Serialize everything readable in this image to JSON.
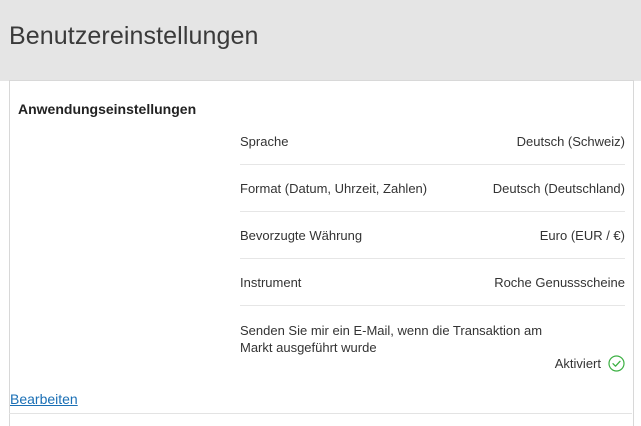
{
  "header": {
    "title": "Benutzereinstellungen"
  },
  "section": {
    "title": "Anwendungseinstellungen"
  },
  "settings": [
    {
      "label": "Sprache",
      "value": "Deutsch (Schweiz)"
    },
    {
      "label": "Format (Datum, Uhrzeit, Zahlen)",
      "value": "Deutsch (Deutschland)"
    },
    {
      "label": "Bevorzugte Währung",
      "value": "Euro (EUR / €)"
    },
    {
      "label": "Instrument",
      "value": "Roche Genussscheine"
    }
  ],
  "email_notification": {
    "label": "Senden Sie mir ein E-Mail, wenn die Transaktion am Markt ausgeführt wurde",
    "status": "Aktiviert",
    "status_icon": "check-circle-icon",
    "status_color": "#3cb043"
  },
  "actions": {
    "edit_label": "Bearbeiten"
  },
  "colors": {
    "header_bg": "#e5e5e5",
    "link": "#1a6fb5"
  }
}
